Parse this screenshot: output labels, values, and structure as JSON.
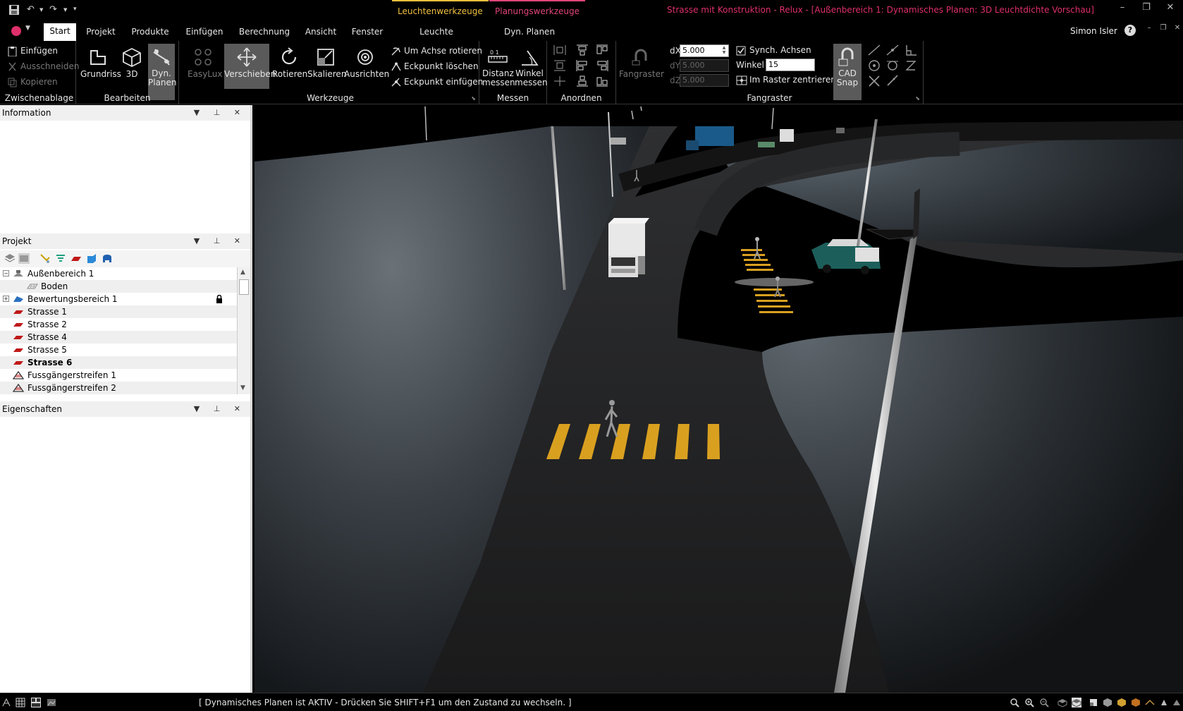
{
  "titlebar": {
    "context_tab_leuchten": "Leuchtenwerkzeuge",
    "context_tab_planung": "Planungswerkzeuge",
    "window_title": "Strasse mit Konstruktion - Relux - [Außenbereich 1: Dynamisches Planen: 3D Leuchtdichte Vorschau]"
  },
  "tabs": {
    "start": "Start",
    "projekt": "Projekt",
    "produkte": "Produkte",
    "einfuegen": "Einfügen",
    "berechnung": "Berechnung",
    "ansicht": "Ansicht",
    "fenster": "Fenster",
    "leuchte": "Leuchte",
    "dyn_planen": "Dyn. Planen"
  },
  "user": {
    "name": "Simon Isler"
  },
  "ribbon": {
    "zwischenablage": {
      "label": "Zwischenablage",
      "einfuegen": "Einfügen",
      "ausschneiden": "Ausschneiden",
      "kopieren": "Kopieren"
    },
    "bearbeiten": {
      "label": "Bearbeiten",
      "grundriss": "Grundriss",
      "three_d": "3D",
      "dyn_planen_1": "Dyn.",
      "dyn_planen_2": "Planen"
    },
    "werkzeuge": {
      "label": "Werkzeuge",
      "easylux": "EasyLux",
      "verschieben": "Verschieben",
      "rotieren": "Rotieren",
      "skalieren": "Skalieren",
      "ausrichten": "Ausrichten",
      "um_achse_rotieren": "Um Achse rotieren",
      "eckpunkt_loeschen": "Eckpunkt löschen",
      "eckpunkt_einfuegen": "Eckpunkt einfügen"
    },
    "messen": {
      "label": "Messen",
      "distanz_1": "Distanz",
      "distanz_2": "messen",
      "winkel_1": "Winkel",
      "winkel_2": "messen"
    },
    "anordnen": {
      "label": "Anordnen"
    },
    "fangraster": {
      "label": "Fangraster",
      "fangraster_btn": "Fangraster",
      "dx_label": "dX",
      "dx_value": "5.000",
      "dy_label": "dY",
      "dy_value": "5.000",
      "dz_label": "dZ",
      "dz_value": "5.000",
      "synch_achsen": "Synch. Achsen",
      "winkel_label": "Winkel",
      "winkel_value": "15",
      "im_raster_zentrieren": "Im Raster zentrieren",
      "cad_1": "CAD",
      "cad_2": "Snap"
    }
  },
  "panels": {
    "information": {
      "title": "Information"
    },
    "projekt": {
      "title": "Projekt",
      "tree": [
        {
          "label": "Außenbereich 1"
        },
        {
          "label": "Boden"
        },
        {
          "label": "Bewertungsbereich 1"
        },
        {
          "label": "Strasse 1"
        },
        {
          "label": "Strasse 2"
        },
        {
          "label": "Strasse 4"
        },
        {
          "label": "Strasse 5"
        },
        {
          "label": "Strasse 6"
        },
        {
          "label": "Fussgängerstreifen 1"
        },
        {
          "label": "Fussgängerstreifen 2"
        }
      ]
    },
    "eigenschaften": {
      "title": "Eigenschaften"
    }
  },
  "statusbar": {
    "message": "[ Dynamisches Planen ist AKTIV - Drücken Sie SHIFT+F1 um den Zustand zu wechseln. ]"
  },
  "colors": {
    "accent_pink": "#e0306a",
    "accent_gold": "#f0c040",
    "crosswalk": "#d9a020"
  }
}
